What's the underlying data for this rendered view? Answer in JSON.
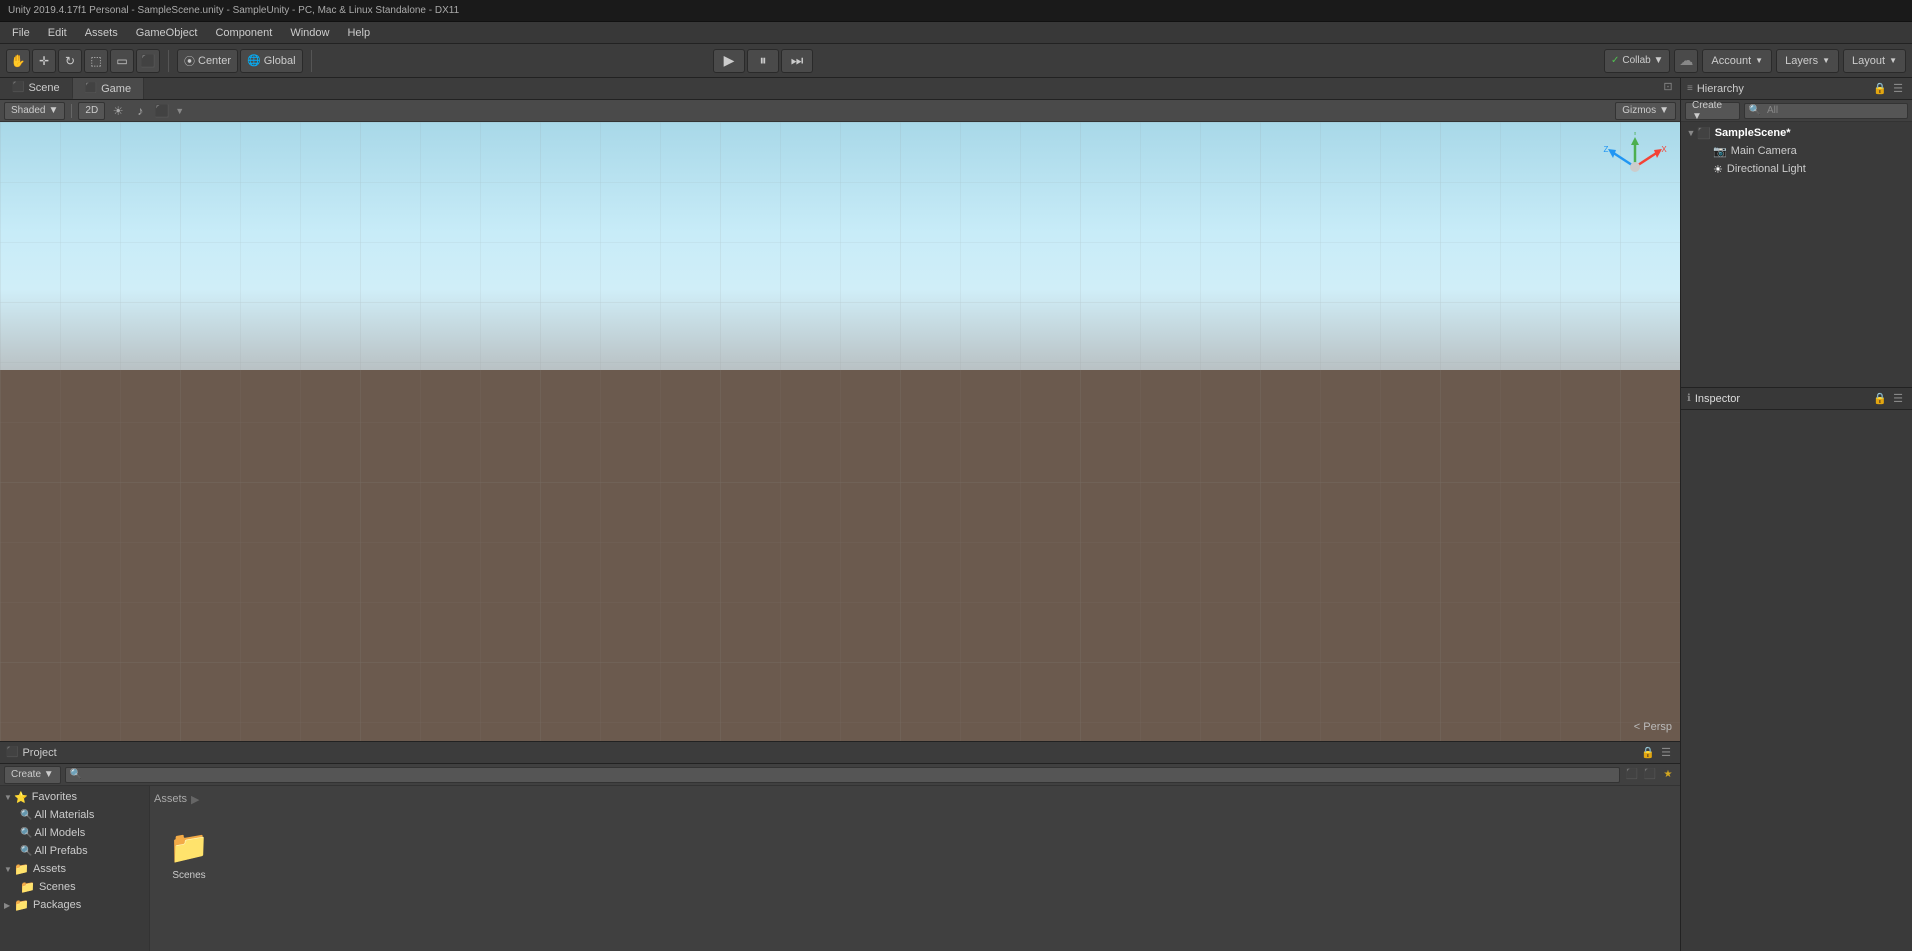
{
  "titlebar": {
    "text": "Unity 2019.4.17f1 Personal - SampleScene.unity - SampleUnity - PC, Mac & Linux Standalone - DX11"
  },
  "menubar": {
    "items": [
      "File",
      "Edit",
      "Assets",
      "GameObject",
      "Component",
      "Window",
      "Help"
    ]
  },
  "toolbar": {
    "transform_tools": [
      "⬛",
      "✛",
      "⟳",
      "⬛",
      "⬛",
      "⬛"
    ],
    "center_label": "Center",
    "global_label": "Global",
    "play_icon": "▶",
    "pause_icon": "⏸",
    "step_icon": "⏭",
    "collab_label": "Collab ▼",
    "cloud_icon": "☁",
    "account_label": "Account",
    "account_arrow": "▼",
    "layers_label": "Layers",
    "layers_arrow": "▼",
    "layout_label": "Layout",
    "layout_arrow": "▼"
  },
  "viewport": {
    "tabs": [
      {
        "id": "scene",
        "label": "Scene",
        "icon": "⬛",
        "active": true
      },
      {
        "id": "game",
        "label": "Game",
        "icon": "⬛",
        "active": false
      }
    ],
    "toolbar": {
      "shaded_label": "Shaded",
      "2d_label": "2D",
      "gizmos_label": "Gizmos",
      "gizmos_arrow": "▼"
    },
    "persp_label": "< Persp"
  },
  "hierarchy": {
    "title": "Hierarchy",
    "title_icon": "≡",
    "create_label": "Create ▼",
    "search_placeholder": "All",
    "tree": {
      "root": {
        "label": "SampleScene*",
        "icon": "⬛",
        "children": [
          {
            "label": "Main Camera",
            "icon": "📷"
          },
          {
            "label": "Directional Light",
            "icon": "☀"
          }
        ]
      }
    }
  },
  "inspector": {
    "title": "Inspector",
    "title_icon": "ℹ"
  },
  "project": {
    "title": "Project",
    "title_icon": "⬛",
    "create_label": "Create ▼",
    "search_placeholder": "",
    "favorites": {
      "label": "Favorites",
      "items": [
        "All Materials",
        "All Models",
        "All Prefabs"
      ]
    },
    "assets": {
      "label": "Assets",
      "children": [
        {
          "label": "Scenes"
        }
      ]
    },
    "packages": {
      "label": "Packages"
    },
    "right_panel": {
      "assets_label": "Assets",
      "folders": [
        "Scenes"
      ]
    }
  }
}
